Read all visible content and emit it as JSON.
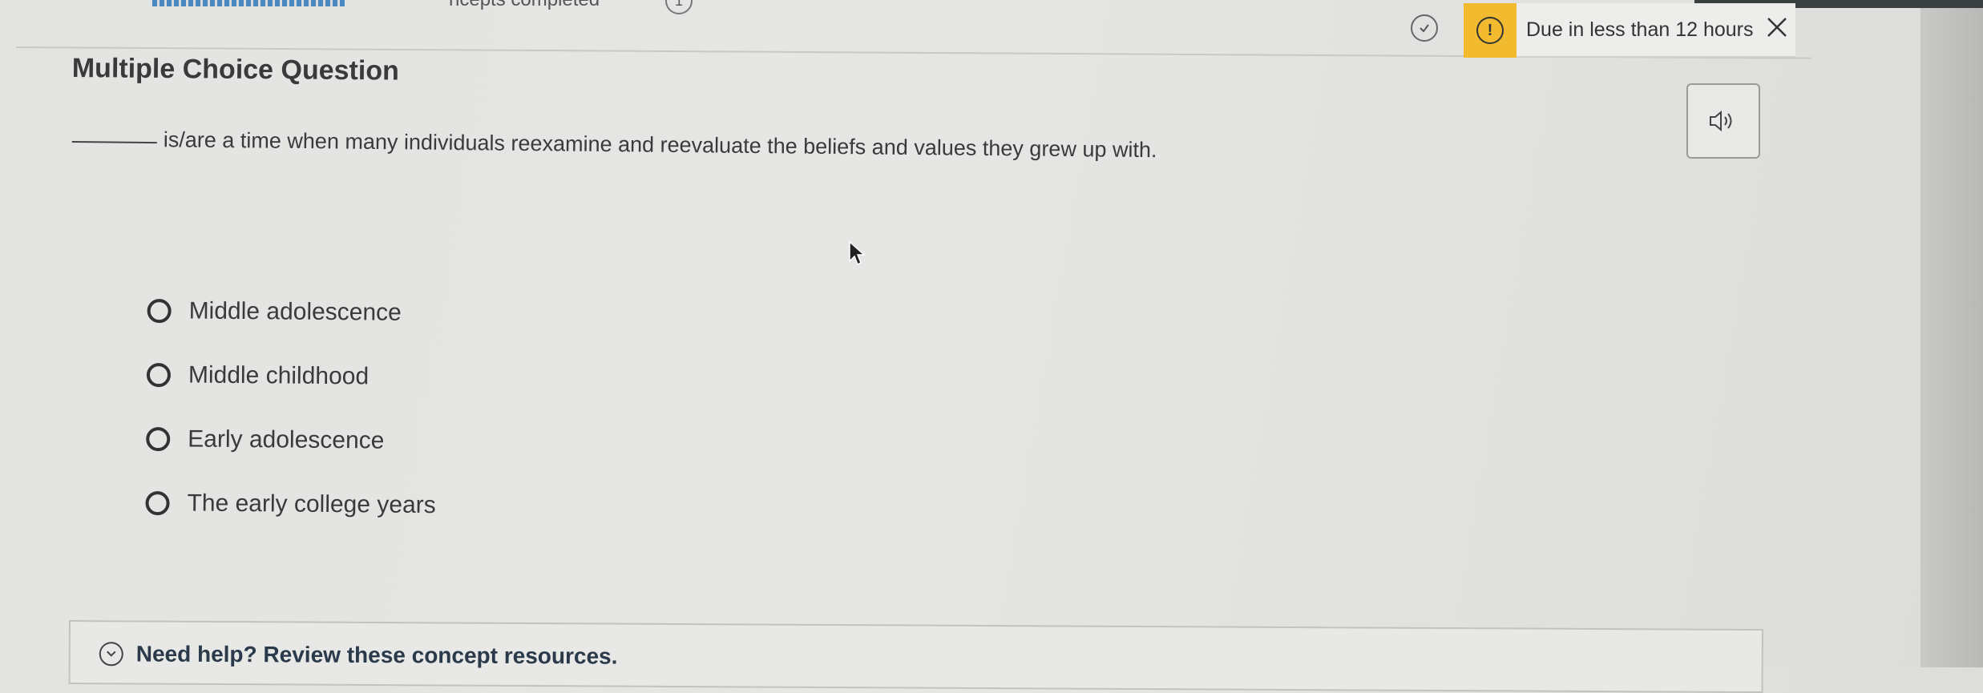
{
  "header": {
    "concepts_completed_partial": "ncepts completed",
    "concepts_count": "1",
    "due_text": "Due in less than 12 hours",
    "warning_glyph": "!"
  },
  "question": {
    "type_title": "Multiple Choice Question",
    "text": "is/are a time when many individuals reexamine and reevaluate the beliefs and values they grew up with."
  },
  "options": [
    {
      "label": "Middle adolescence",
      "selected": false
    },
    {
      "label": "Middle childhood",
      "selected": false
    },
    {
      "label": "Early adolescence",
      "selected": false
    },
    {
      "label": "The early college years",
      "selected": false
    }
  ],
  "help": {
    "label": "Need help? Review these concept resources."
  },
  "colors": {
    "warning": "#f1ba2f",
    "progress": "#4a88c2"
  },
  "icons": {
    "check": "check-circle-icon",
    "warning": "warning-icon",
    "close": "close-icon",
    "speaker": "speaker-icon",
    "chevron": "chevron-down-icon",
    "cursor": "mouse-pointer-icon"
  }
}
